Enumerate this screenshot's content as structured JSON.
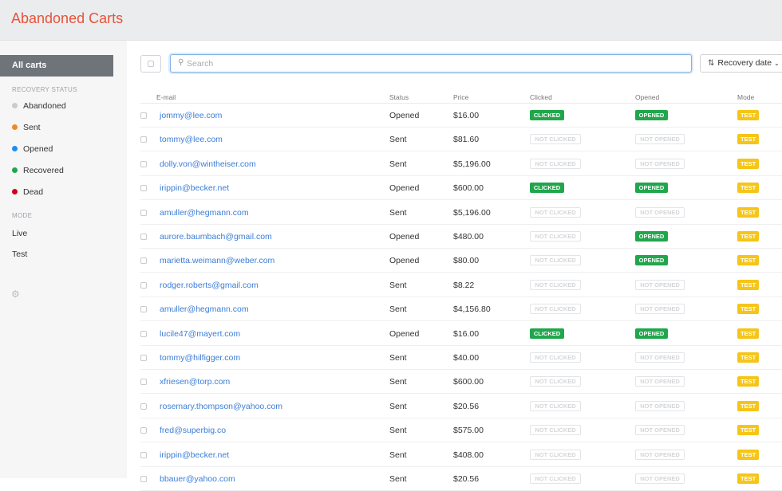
{
  "app": {
    "title": "Abandoned Carts"
  },
  "sidebar": {
    "all_carts": "All carts",
    "recovery_heading": "RECOVERY STATUS",
    "statuses": [
      {
        "label": "Abandoned",
        "color": "#c9cbce"
      },
      {
        "label": "Sent",
        "color": "#f08a24"
      },
      {
        "label": "Opened",
        "color": "#1c8ef0"
      },
      {
        "label": "Recovered",
        "color": "#21a64c"
      },
      {
        "label": "Dead",
        "color": "#d0021b"
      }
    ],
    "mode_heading": "MODE",
    "modes": [
      "Live",
      "Test"
    ],
    "settings_icon": "gear-icon"
  },
  "toolbar": {
    "search_placeholder": "Search",
    "sort_label": "Recovery date"
  },
  "table": {
    "columns": [
      "E-mail",
      "Status",
      "Price",
      "Clicked",
      "Opened",
      "Mode"
    ],
    "badges": {
      "clicked": "CLICKED",
      "not_clicked": "NOT CLICKED",
      "opened": "OPENED",
      "not_opened": "NOT OPENED",
      "test": "TEST"
    },
    "rows": [
      {
        "email": "jommy@lee.com",
        "status": "Opened",
        "price": "$16.00",
        "clicked": true,
        "opened": true,
        "mode": "TEST"
      },
      {
        "email": "tommy@lee.com",
        "status": "Sent",
        "price": "$81.60",
        "clicked": false,
        "opened": false,
        "mode": "TEST"
      },
      {
        "email": "dolly.von@wintheiser.com",
        "status": "Sent",
        "price": "$5,196.00",
        "clicked": false,
        "opened": false,
        "mode": "TEST"
      },
      {
        "email": "irippin@becker.net",
        "status": "Opened",
        "price": "$600.00",
        "clicked": true,
        "opened": true,
        "mode": "TEST"
      },
      {
        "email": "amuller@hegmann.com",
        "status": "Sent",
        "price": "$5,196.00",
        "clicked": false,
        "opened": false,
        "mode": "TEST"
      },
      {
        "email": "aurore.baumbach@gmail.com",
        "status": "Opened",
        "price": "$480.00",
        "clicked": false,
        "opened": true,
        "mode": "TEST"
      },
      {
        "email": "marietta.weimann@weber.com",
        "status": "Opened",
        "price": "$80.00",
        "clicked": false,
        "opened": true,
        "mode": "TEST"
      },
      {
        "email": "rodger.roberts@gmail.com",
        "status": "Sent",
        "price": "$8.22",
        "clicked": false,
        "opened": false,
        "mode": "TEST"
      },
      {
        "email": "amuller@hegmann.com",
        "status": "Sent",
        "price": "$4,156.80",
        "clicked": false,
        "opened": false,
        "mode": "TEST"
      },
      {
        "email": "lucile47@mayert.com",
        "status": "Opened",
        "price": "$16.00",
        "clicked": true,
        "opened": true,
        "mode": "TEST"
      },
      {
        "email": "tommy@hilfigger.com",
        "status": "Sent",
        "price": "$40.00",
        "clicked": false,
        "opened": false,
        "mode": "TEST"
      },
      {
        "email": "xfriesen@torp.com",
        "status": "Sent",
        "price": "$600.00",
        "clicked": false,
        "opened": false,
        "mode": "TEST"
      },
      {
        "email": "rosemary.thompson@yahoo.com",
        "status": "Sent",
        "price": "$20.56",
        "clicked": false,
        "opened": false,
        "mode": "TEST"
      },
      {
        "email": "fred@superbig.co",
        "status": "Sent",
        "price": "$575.00",
        "clicked": false,
        "opened": false,
        "mode": "TEST"
      },
      {
        "email": "irippin@becker.net",
        "status": "Sent",
        "price": "$408.00",
        "clicked": false,
        "opened": false,
        "mode": "TEST"
      },
      {
        "email": "bbauer@yahoo.com",
        "status": "Sent",
        "price": "$20.56",
        "clicked": false,
        "opened": false,
        "mode": "TEST"
      }
    ]
  }
}
